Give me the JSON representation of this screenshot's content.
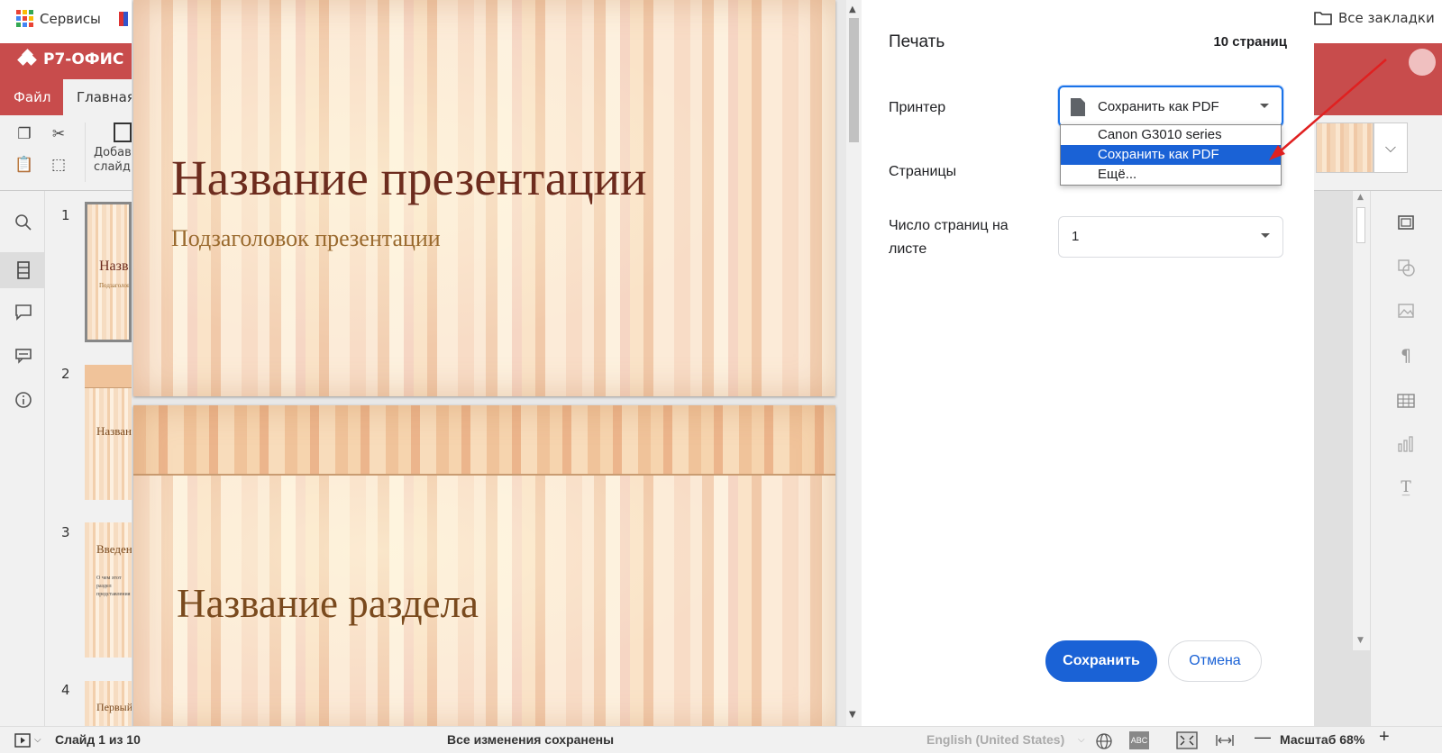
{
  "browser": {
    "bookmarks": {
      "services_label": "Сервисы",
      "all_bookmarks_label": "Все закладки"
    }
  },
  "editor": {
    "brand": "Р7-ОФИС",
    "tabs": [
      "Файл",
      "Главная"
    ],
    "toolbar": {
      "add_slide_label": "Добавить слайд"
    },
    "thumbnails": [
      {
        "number": "1",
        "title": "Название",
        "subtitle": "Подзаголовок"
      },
      {
        "number": "2",
        "title": "Название"
      },
      {
        "number": "3",
        "title": "Введение",
        "body": "О чем этот раздел представления"
      },
      {
        "number": "4",
        "title": "Первый"
      }
    ]
  },
  "preview": {
    "slides": [
      {
        "title": "Название презентации",
        "subtitle": "Подзаголовок презентации"
      },
      {
        "title": "Название раздела"
      }
    ]
  },
  "print_dialog": {
    "title": "Печать",
    "page_count": "10 страниц",
    "printer_label": "Принтер",
    "printer_value": "Сохранить как PDF",
    "printer_options": [
      "Canon G3010 series",
      "Сохранить как PDF",
      "Ещё..."
    ],
    "printer_selected_index": 1,
    "pages_label": "Страницы",
    "pages_per_sheet_label": "Число страниц на листе",
    "pages_per_sheet_value": "1",
    "save_button": "Сохранить",
    "cancel_button": "Отмена"
  },
  "statusbar": {
    "slide_indicator": "Слайд 1 из 10",
    "save_status": "Все изменения сохранены",
    "language": "English (United States)",
    "zoom": "Масштаб 68%"
  },
  "colors": {
    "brand_red": "#c84c4c",
    "primary_blue": "#1a62d6",
    "slide_title": "#6d2c1e",
    "slide_subtitle": "#9a6a2e",
    "annotation_arrow": "#e02020"
  },
  "icons": {
    "apps": "apps-grid-icon",
    "bookmarks_folder": "folder-icon",
    "search": "search-icon",
    "slides": "slides-icon",
    "comments": "comment-icon",
    "chat": "chat-icon",
    "info": "info-icon"
  }
}
